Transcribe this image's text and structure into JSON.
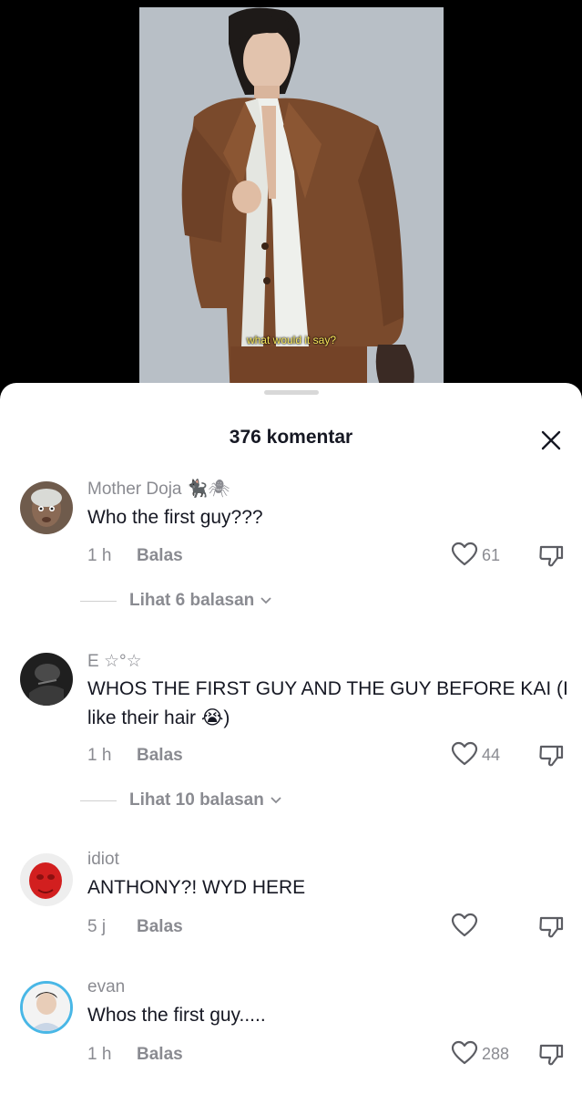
{
  "video": {
    "caption": "what would it say?"
  },
  "sheet": {
    "title": "376 komentar"
  },
  "comments": [
    {
      "username": "Mother Doja 🐈‍⬛🕷",
      "text": "Who the first guy???",
      "time": "1 h",
      "reply_label": "Balas",
      "likes": "61",
      "view_replies": "Lihat 6 balasan"
    },
    {
      "username": "E ☆°☆",
      "text": "WHOS THE FIRST GUY AND THE GUY BEFORE KAI (I like their hair 😭)",
      "time": "1 h",
      "reply_label": "Balas",
      "likes": "44",
      "view_replies": "Lihat 10 balasan"
    },
    {
      "username": "idiot",
      "text": "ANTHONY?! WYD HERE",
      "time": "5 j",
      "reply_label": "Balas",
      "likes": ""
    },
    {
      "username": "evan",
      "text": "Whos the first guy.....",
      "time": "1 h",
      "reply_label": "Balas",
      "likes": "288"
    }
  ]
}
